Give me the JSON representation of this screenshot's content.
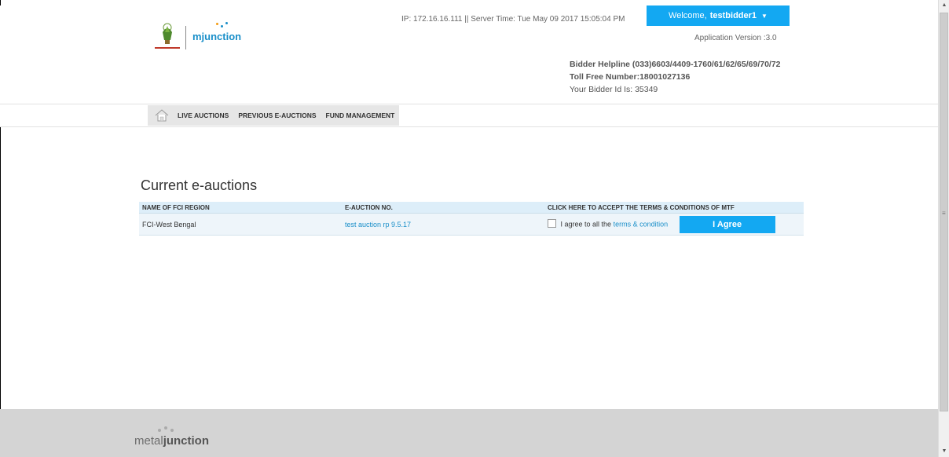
{
  "header": {
    "ip_line": "IP: 172.16.16.111 || Server Time: Tue May 09 2017 15:05:04 PM",
    "welcome_prefix": "Welcome,",
    "username": "testbidder1",
    "app_version": "Application Version :3.0",
    "helpline": "Bidder Helpline (033)6603/4409-1760/61/62/65/69/70/72",
    "toll_free": "Toll Free Number:18001027136",
    "bidder_id": "Your Bidder Id Is: 35349",
    "logo_text": "mjunction"
  },
  "nav": {
    "items": [
      {
        "label": "LIVE AUCTIONS"
      },
      {
        "label": "PREVIOUS E-AUCTIONS"
      },
      {
        "label": "FUND MANAGEMENT"
      }
    ]
  },
  "main": {
    "title": "Current e-auctions",
    "columns": [
      "NAME OF FCI REGION",
      "E-AUCTION NO.",
      "CLICK HERE TO ACCEPT THE TERMS & CONDITIONS OF MTF"
    ],
    "rows": [
      {
        "region": "FCI-West Bengal",
        "auction_no": "test auction rp 9.5.17",
        "agree_text": "I agree to all the",
        "terms_link": "terms & condition",
        "agree_button": "I Agree"
      }
    ]
  },
  "footer": {
    "logo_prefix": "metal",
    "logo_suffix": "junction"
  },
  "colors": {
    "accent": "#13a8f2",
    "link": "#1a8fc9",
    "table_header": "#ddeef9",
    "footer": "#d4d4d4"
  }
}
